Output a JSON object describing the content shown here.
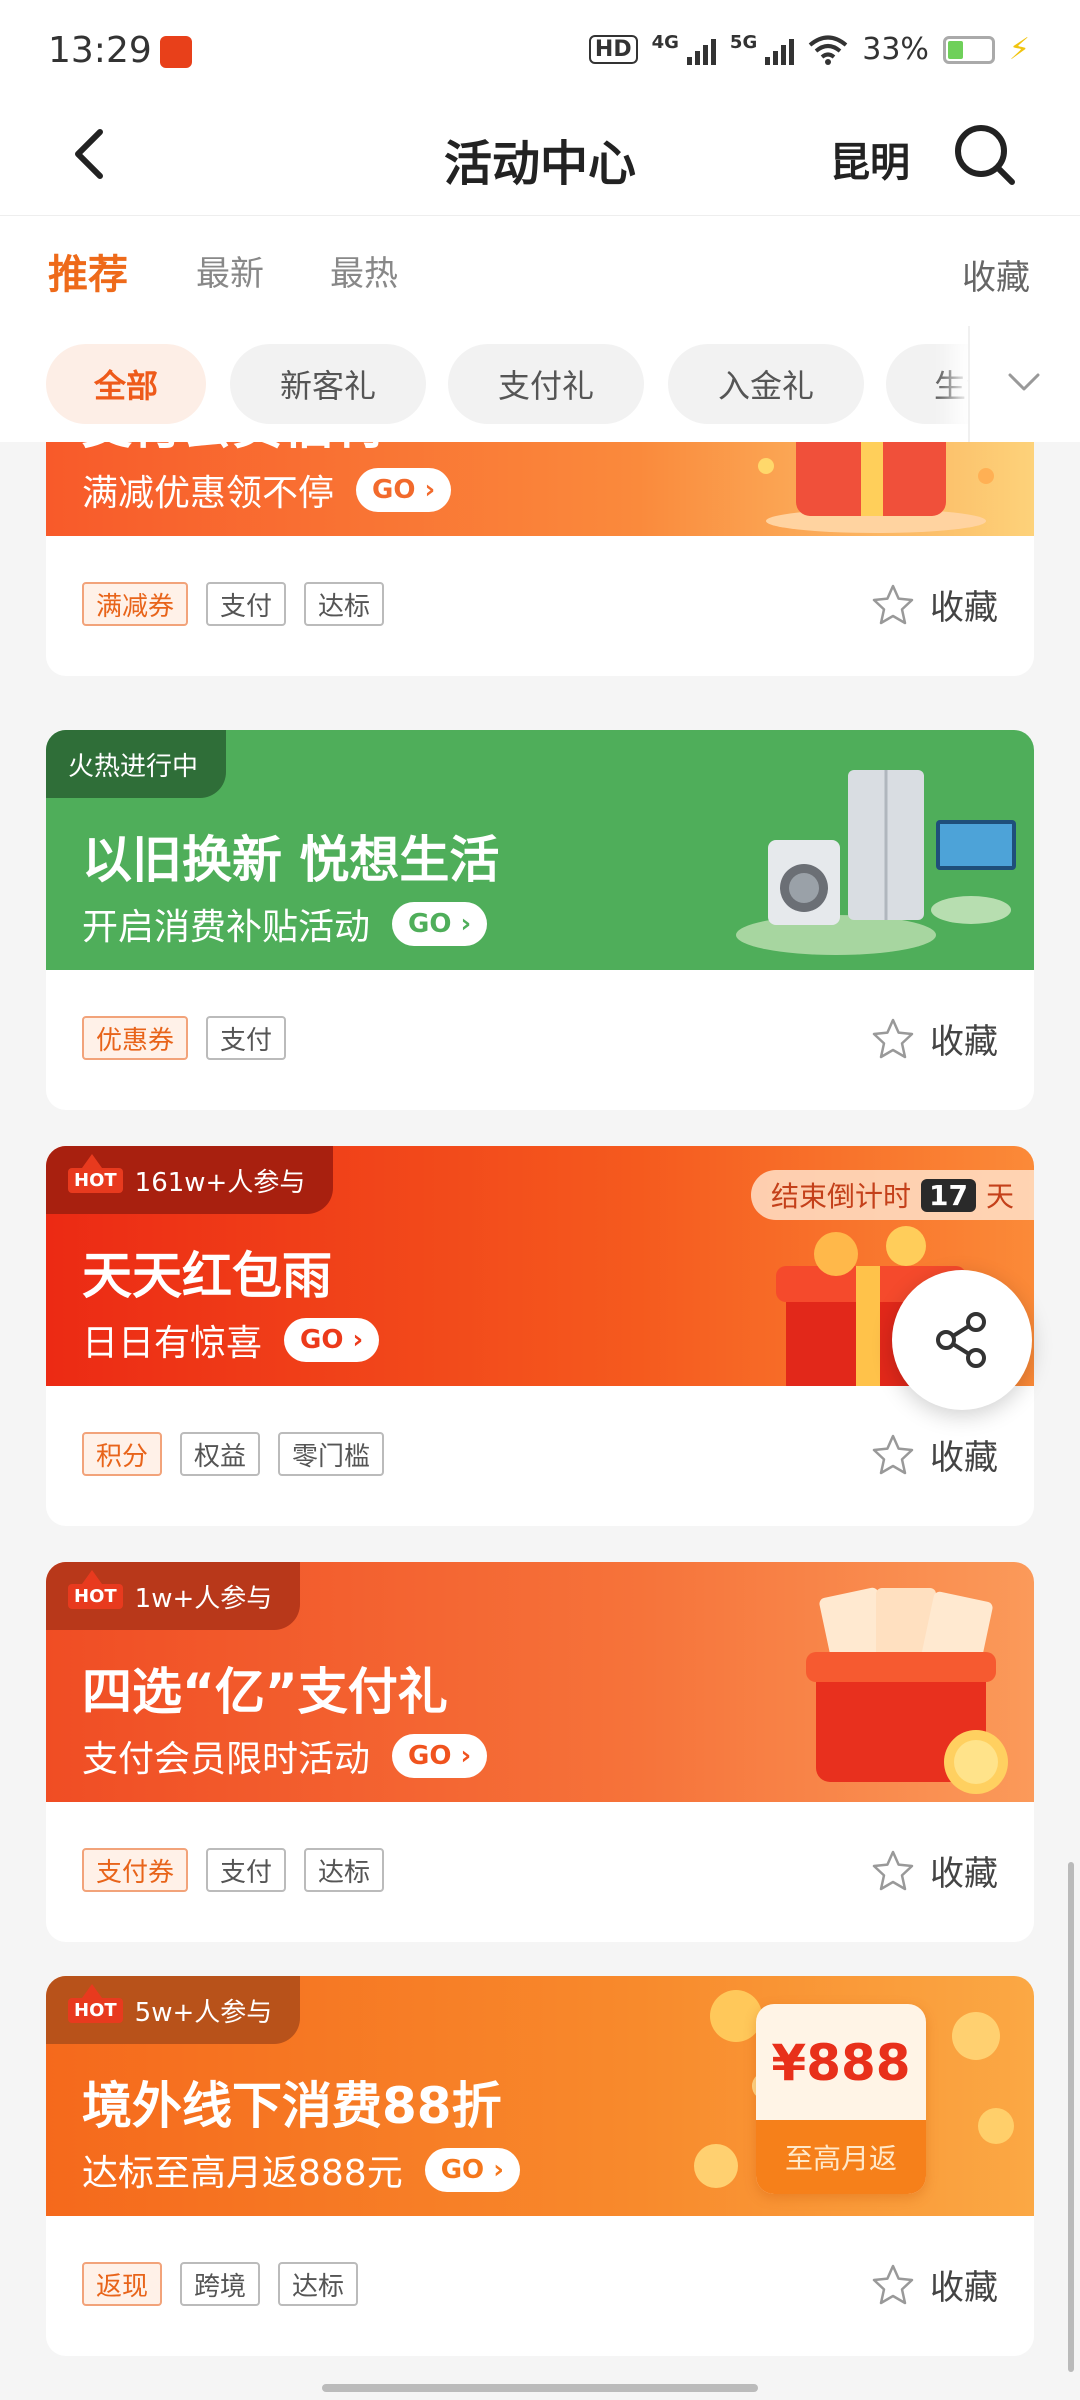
{
  "status_bar": {
    "time": "13:29",
    "hd_label": "HD",
    "net1": "4G",
    "net2": "5G",
    "battery": "33%",
    "battery_level": 0.33
  },
  "nav": {
    "title": "活动中心",
    "city": "昆明"
  },
  "tabs": [
    {
      "label": "推荐",
      "active": true
    },
    {
      "label": "最新",
      "active": false
    },
    {
      "label": "最热",
      "active": false
    }
  ],
  "tabs_favorite": "收藏",
  "chips": [
    {
      "label": "全部",
      "active": true
    },
    {
      "label": "新客礼",
      "active": false
    },
    {
      "label": "支付礼",
      "active": false
    },
    {
      "label": "入金礼",
      "active": false
    },
    {
      "label": "生活",
      "active": false
    }
  ],
  "go_label": "GO",
  "favorite_label": "收藏",
  "cards": [
    {
      "title": "支付会员福利",
      "subtitle": "满减优惠领不停",
      "tags": [
        "满减券",
        "支付",
        "达标"
      ],
      "color": "#f86a2c"
    },
    {
      "badge": "火热进行中",
      "title": "以旧换新 悦想生活",
      "subtitle": "开启消费补贴活动",
      "tags": [
        "优惠券",
        "支付"
      ],
      "color": "#4fae5a"
    },
    {
      "badge": "161w+人参与",
      "hot": "HOT",
      "title": "天天红包雨",
      "subtitle": "日日有惊喜",
      "countdown_prefix": "结束倒计时",
      "countdown_value": "17",
      "countdown_unit": "天",
      "tags": [
        "积分",
        "权益",
        "零门槛"
      ],
      "color": "#f1431c"
    },
    {
      "badge": "1w+人参与",
      "hot": "HOT",
      "title": "四选“亿”支付礼",
      "subtitle": "支付会员限时活动",
      "tags": [
        "支付券",
        "支付",
        "达标"
      ],
      "color": "#f4622c"
    },
    {
      "badge": "5w+人参与",
      "hot": "HOT",
      "title": "境外线下消费88折",
      "subtitle": "达标至高月返888元",
      "art_amount": "¥888",
      "art_caption": "至高月返",
      "tags": [
        "返现",
        "跨境",
        "达标"
      ],
      "color": "#f67a22"
    }
  ]
}
